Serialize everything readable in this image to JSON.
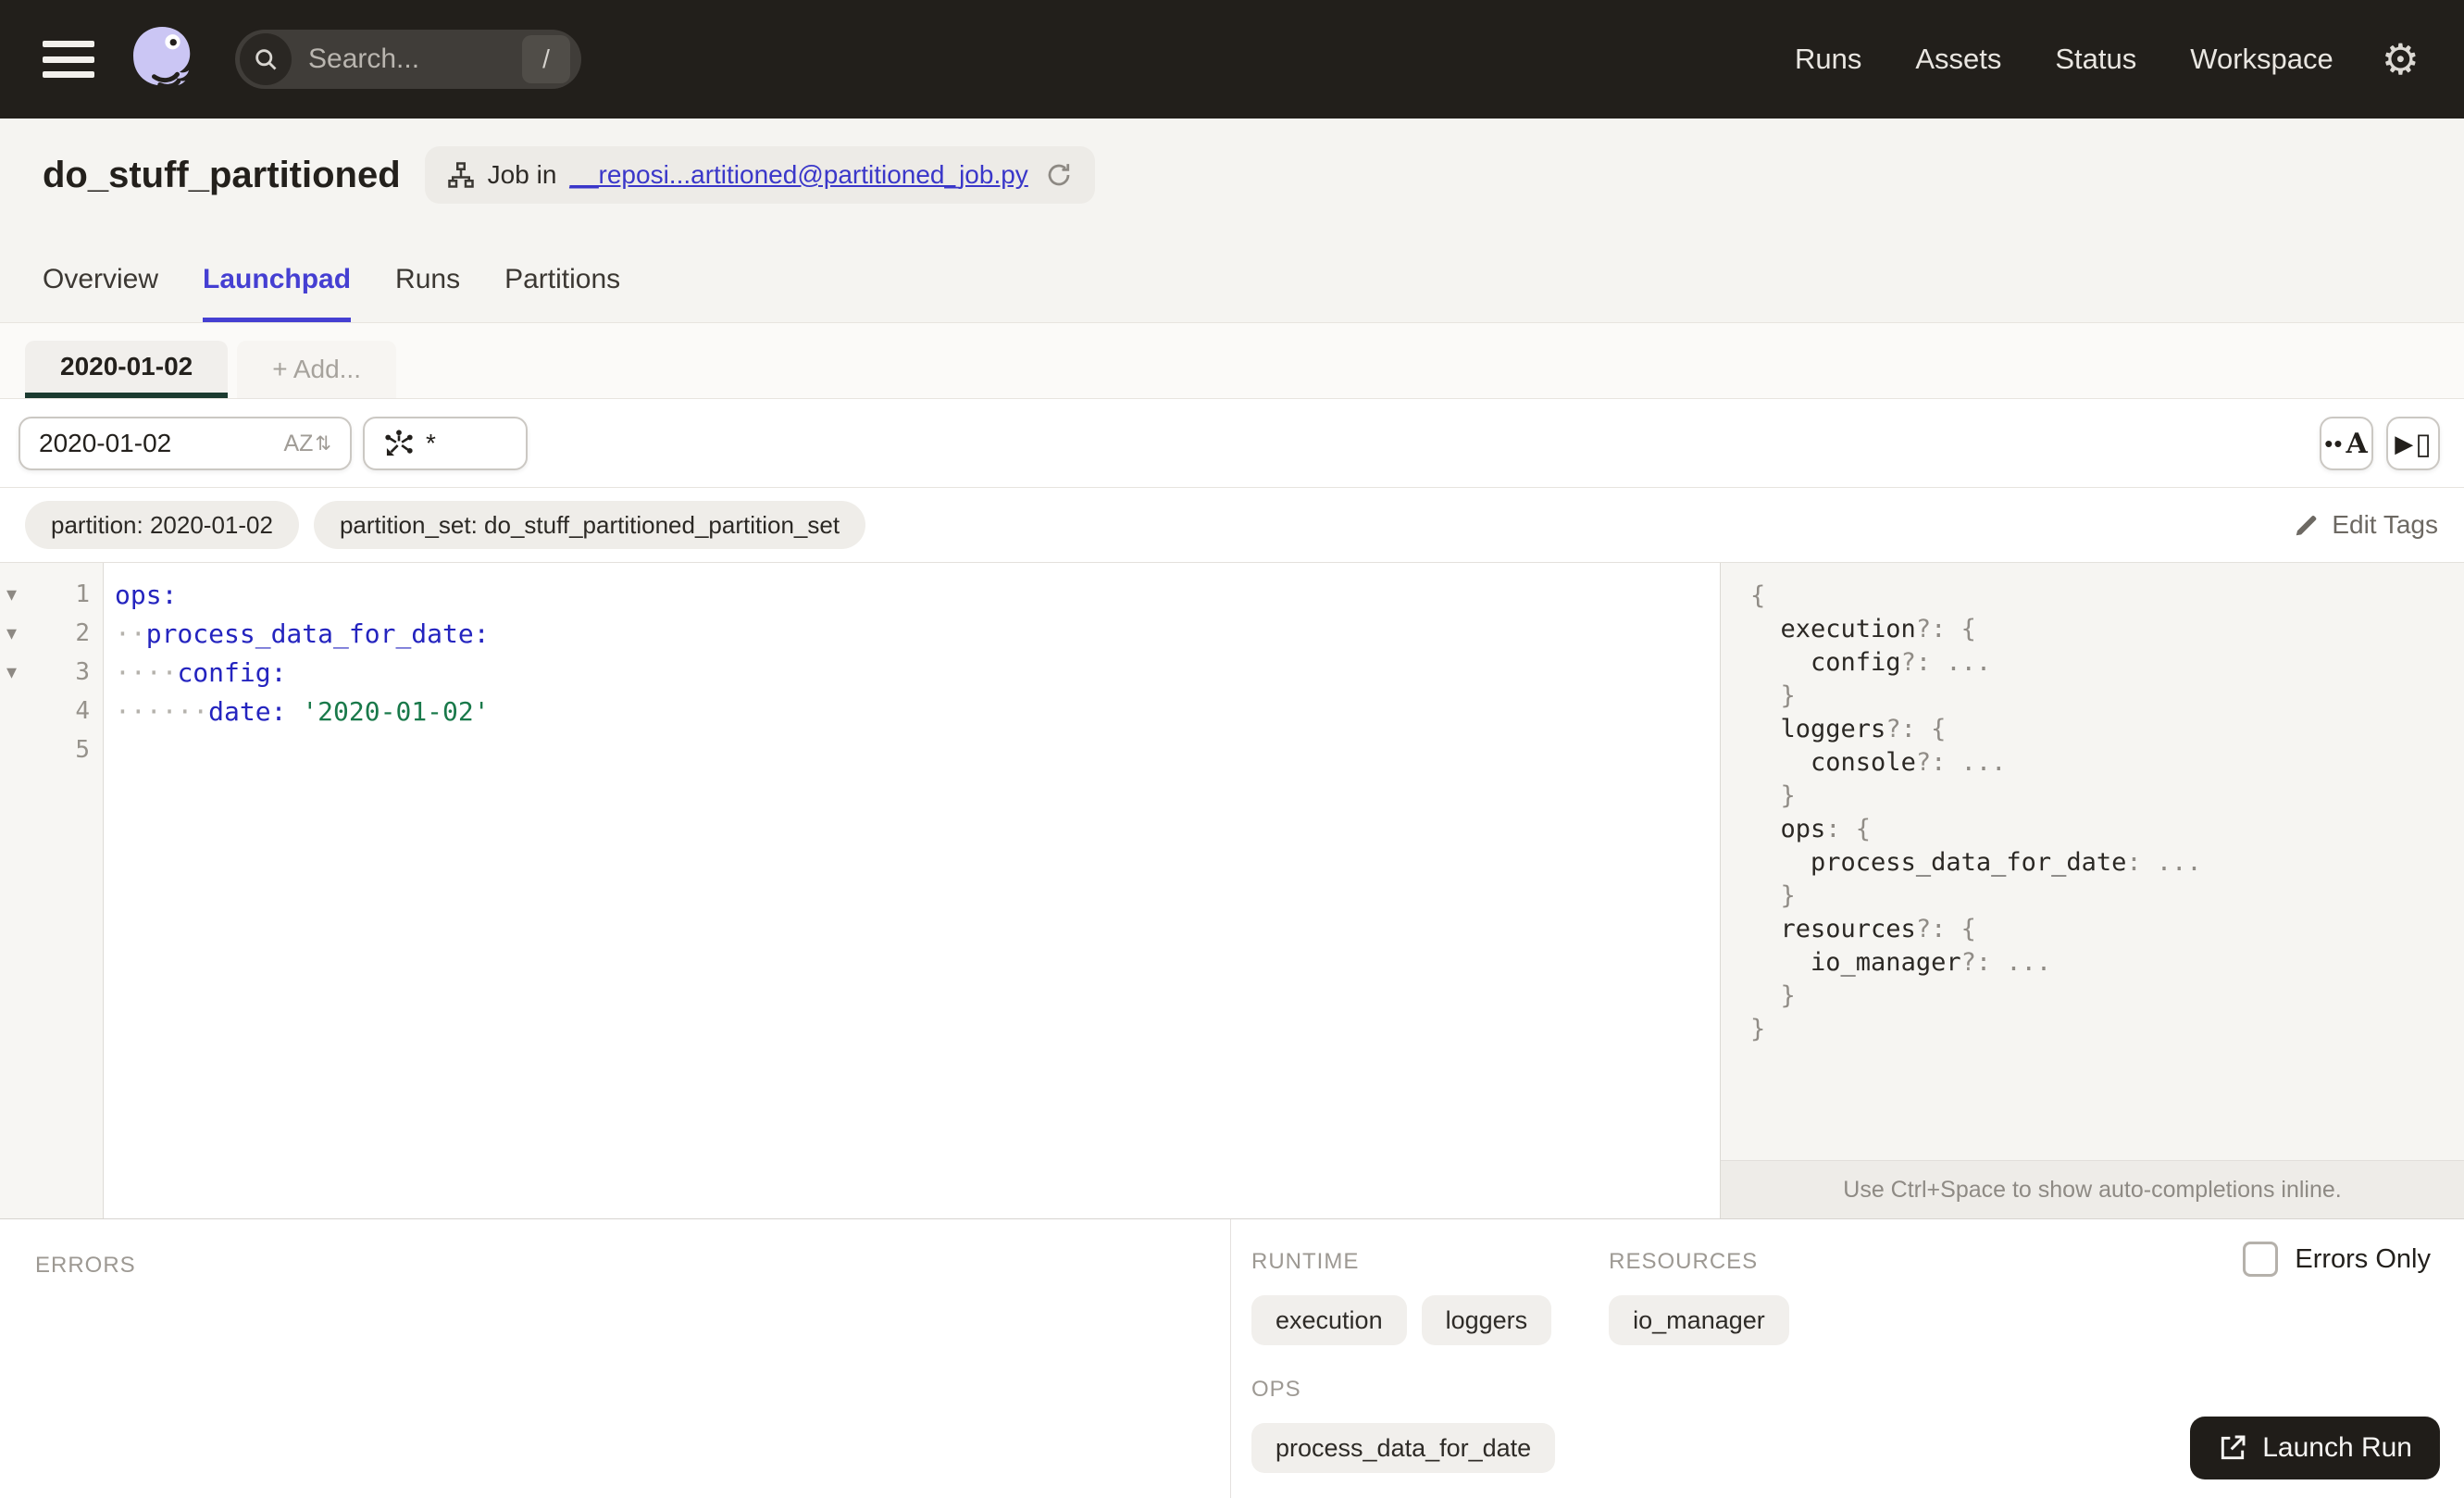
{
  "topbar": {
    "search_placeholder": "Search...",
    "search_shortcut": "/",
    "nav": [
      {
        "label": "Runs"
      },
      {
        "label": "Assets"
      },
      {
        "label": "Status"
      },
      {
        "label": "Workspace"
      }
    ]
  },
  "header": {
    "title": "do_stuff_partitioned",
    "job_pill": {
      "prefix": "Job in",
      "link": "__reposi...artitioned@partitioned_job.py"
    },
    "tabs": [
      {
        "label": "Overview",
        "active": false
      },
      {
        "label": "Launchpad",
        "active": true
      },
      {
        "label": "Runs",
        "active": false
      },
      {
        "label": "Partitions",
        "active": false
      }
    ]
  },
  "launchpad": {
    "partition_tabs": [
      {
        "label": "2020-01-02",
        "active": true
      }
    ],
    "add_tab_label": "+ Add...",
    "partition_select_value": "2020-01-02",
    "scaffold_value": "*",
    "tags": [
      "partition: 2020-01-02",
      "partition_set: do_stuff_partitioned_partition_set"
    ],
    "edit_tags_label": "Edit Tags"
  },
  "editor": {
    "lines": [
      {
        "number": "1",
        "fold": true,
        "dots": 0,
        "key": "ops:",
        "value": ""
      },
      {
        "number": "2",
        "fold": true,
        "dots": 2,
        "key": "process_data_for_date:",
        "value": ""
      },
      {
        "number": "3",
        "fold": true,
        "dots": 4,
        "key": "config:",
        "value": ""
      },
      {
        "number": "4",
        "fold": false,
        "dots": 6,
        "key": "date:",
        "value": "'2020-01-02'"
      },
      {
        "number": "5",
        "fold": false,
        "dots": 0,
        "key": "",
        "value": ""
      }
    ]
  },
  "schema_panel": {
    "lines": [
      {
        "indent": 0,
        "segs": [
          {
            "c": "sp",
            "t": "{"
          }
        ]
      },
      {
        "indent": 1,
        "segs": [
          {
            "c": "sk",
            "t": "execution"
          },
          {
            "c": "sp",
            "t": "?: {"
          }
        ]
      },
      {
        "indent": 2,
        "segs": [
          {
            "c": "sk",
            "t": "config"
          },
          {
            "c": "sp",
            "t": "?: ..."
          }
        ]
      },
      {
        "indent": 1,
        "segs": [
          {
            "c": "sp",
            "t": "}"
          }
        ]
      },
      {
        "indent": 1,
        "segs": [
          {
            "c": "sk",
            "t": "loggers"
          },
          {
            "c": "sp",
            "t": "?: {"
          }
        ]
      },
      {
        "indent": 2,
        "segs": [
          {
            "c": "sk",
            "t": "console"
          },
          {
            "c": "sp",
            "t": "?: ..."
          }
        ]
      },
      {
        "indent": 1,
        "segs": [
          {
            "c": "sp",
            "t": "}"
          }
        ]
      },
      {
        "indent": 1,
        "segs": [
          {
            "c": "sk",
            "t": "ops"
          },
          {
            "c": "sp",
            "t": ": {"
          }
        ]
      },
      {
        "indent": 2,
        "segs": [
          {
            "c": "sk",
            "t": "process_data_for_date"
          },
          {
            "c": "sp",
            "t": ": ..."
          }
        ]
      },
      {
        "indent": 1,
        "segs": [
          {
            "c": "sp",
            "t": "}"
          }
        ]
      },
      {
        "indent": 1,
        "segs": [
          {
            "c": "sk",
            "t": "resources"
          },
          {
            "c": "sp",
            "t": "?: {"
          }
        ]
      },
      {
        "indent": 2,
        "segs": [
          {
            "c": "sk",
            "t": "io_manager"
          },
          {
            "c": "sp",
            "t": "?: ..."
          }
        ]
      },
      {
        "indent": 1,
        "segs": [
          {
            "c": "sp",
            "t": "}"
          }
        ]
      },
      {
        "indent": 0,
        "segs": [
          {
            "c": "sp",
            "t": "}"
          }
        ]
      }
    ],
    "hint": "Use Ctrl+Space to show auto-completions inline."
  },
  "bottom": {
    "errors_label": "ERRORS",
    "errors_only_label": "Errors Only",
    "sections": [
      {
        "title": "RUNTIME",
        "pills": [
          "execution",
          "loggers"
        ]
      },
      {
        "title": "RESOURCES",
        "pills": [
          "io_manager"
        ]
      }
    ],
    "ops_section": {
      "title": "OPS",
      "pills": [
        "process_data_for_date"
      ]
    },
    "launch_button_label": "Launch Run"
  },
  "icons": {
    "gear": "⚙",
    "fold_arrow": "▾",
    "sort_up_down": "⇅",
    "whitespace_toggle": "••",
    "whitespace_toggle_letter": "A",
    "panel_toggle_play": "▶",
    "panel_toggle_rect": "▯"
  },
  "colors": {
    "topbar_bg": "#221f1b",
    "header_bg": "#f5f4f1",
    "accent_tab": "#453fd2",
    "link": "#3a37c9",
    "partition_tab_underline": "#1c3b30",
    "yaml_key": "#2424bf",
    "yaml_string": "#19794a",
    "pill_bg": "#f1efec",
    "launch_btn_bg": "#201d19"
  }
}
